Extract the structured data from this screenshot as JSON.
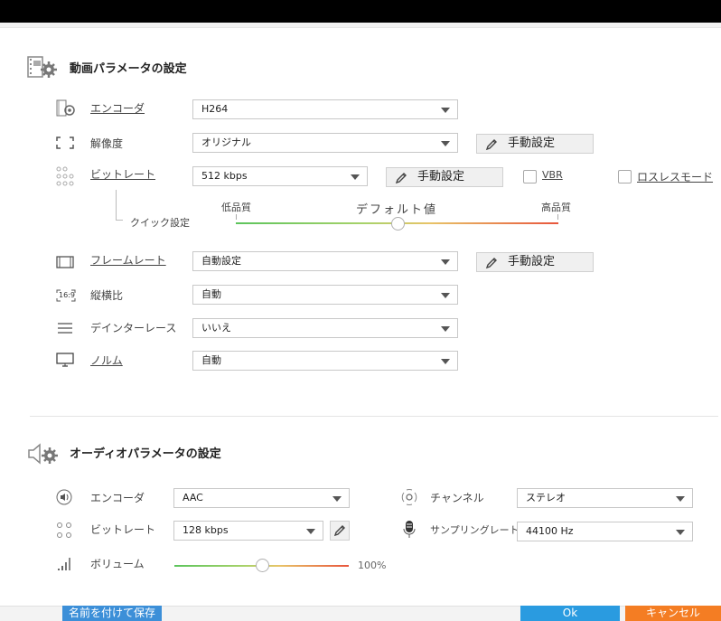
{
  "video_section": {
    "title": "動画パラメータの設定",
    "icon": "video-settings-icon",
    "encoder": {
      "label": "エンコーダ",
      "value": "H264"
    },
    "resolution": {
      "label": "解像度",
      "value": "オリジナル",
      "manual_label": "手動設定"
    },
    "bitrate": {
      "label": "ビットレート",
      "value": "512 kbps",
      "manual_label": "手動設定",
      "vbr_label": "VBR",
      "lossless_label": "ロスレスモード"
    },
    "quick_setting": {
      "label": "クイック設定",
      "low_label": "低品質",
      "default_label": "デフォルト値",
      "high_label": "高品質",
      "level": 0.5
    },
    "framerate": {
      "label": "フレームレート",
      "value": "自動設定",
      "manual_label": "手動設定"
    },
    "aspect": {
      "label": "縦横比",
      "value": "自動",
      "icon_text": "16:9"
    },
    "deinterlace": {
      "label": "デインターレース",
      "value": "いいえ"
    },
    "norm": {
      "label": "ノルム",
      "value": "自動"
    }
  },
  "audio_section": {
    "title": "オーディオパラメータの設定",
    "icon": "audio-settings-icon",
    "encoder": {
      "label": "エンコーダ",
      "value": "AAC"
    },
    "channel": {
      "label": "チャンネル",
      "value": "ステレオ"
    },
    "bitrate": {
      "label": "ビットレート",
      "value": "128 kbps"
    },
    "sample_rate": {
      "label": "サンプリングレート",
      "value": "44100 Hz"
    },
    "volume": {
      "label": "ボリューム",
      "value_text": "100%",
      "level": 0.5
    }
  },
  "footer": {
    "save_as_label": "名前を付けて保存",
    "ok_label": "Ok",
    "cancel_label": "キャンセル",
    "colors": {
      "save_as": "#3c8fd8",
      "ok": "#2a9be0",
      "cancel": "#f47d23"
    }
  }
}
